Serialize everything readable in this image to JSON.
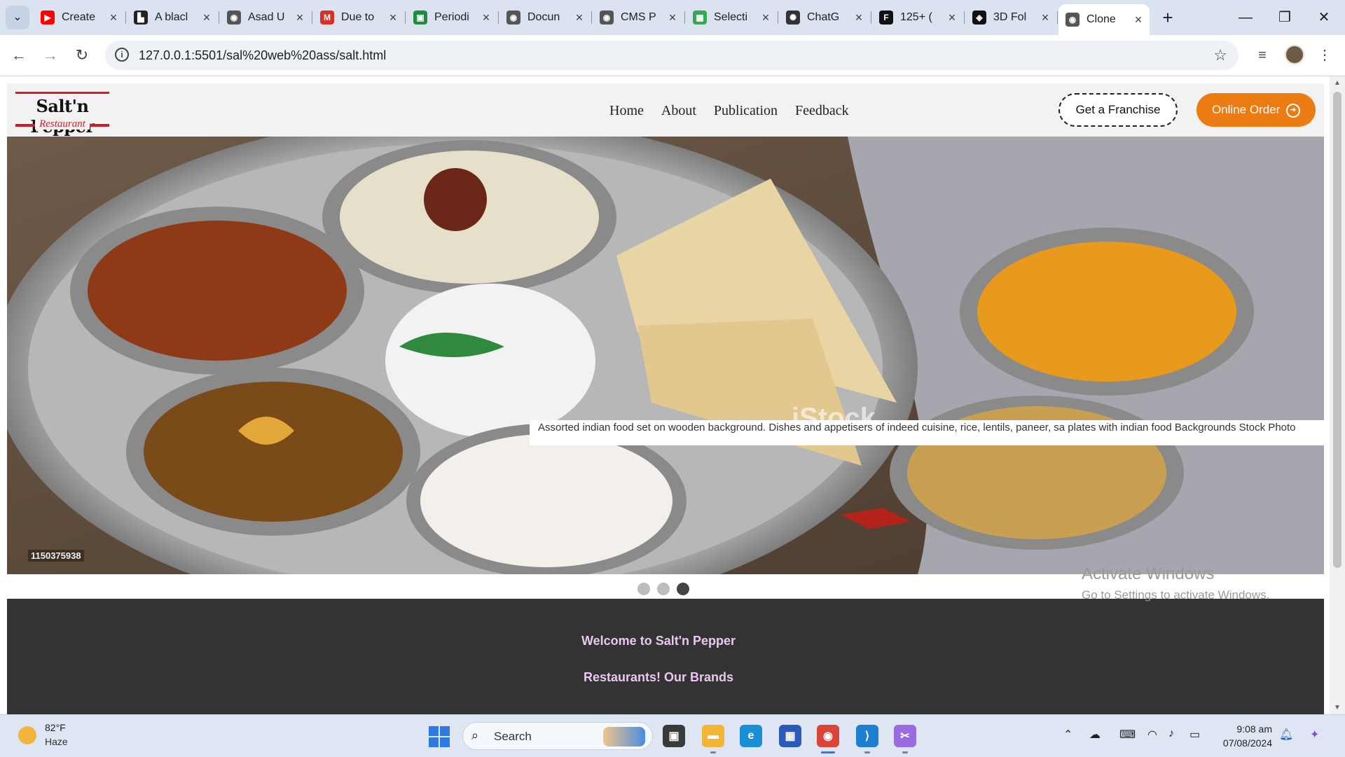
{
  "browser": {
    "tabs": [
      {
        "title": "Create",
        "favicon": "youtube-icon",
        "color": "#ff0000",
        "glyph": "▶"
      },
      {
        "title": "A blacl",
        "favicon": "document-icon",
        "color": "#222222",
        "glyph": "▙"
      },
      {
        "title": "Asad U",
        "favicon": "globe-icon",
        "color": "#555555",
        "glyph": "◉"
      },
      {
        "title": "Due to",
        "favicon": "gmail-icon",
        "color": "#d93025",
        "glyph": "M"
      },
      {
        "title": "Periodi",
        "favicon": "classroom-icon",
        "color": "#1e8e3e",
        "glyph": "▣"
      },
      {
        "title": "Docun",
        "favicon": "globe-icon",
        "color": "#555555",
        "glyph": "◉"
      },
      {
        "title": "CMS P",
        "favicon": "globe-icon",
        "color": "#555555",
        "glyph": "◉"
      },
      {
        "title": "Selecti",
        "favicon": "grid-icon",
        "color": "#34a853",
        "glyph": "▦"
      },
      {
        "title": "ChatG",
        "favicon": "chatgpt-icon",
        "color": "#333333",
        "glyph": "✺"
      },
      {
        "title": "125+ (",
        "favicon": "f-icon",
        "color": "#111111",
        "glyph": "F"
      },
      {
        "title": "3D Fol",
        "favicon": "codepen-icon",
        "color": "#111111",
        "glyph": "◈"
      },
      {
        "title": "Clone",
        "favicon": "globe-icon",
        "color": "#555555",
        "glyph": "◉"
      }
    ],
    "active_tab_index": 11,
    "url": "127.0.0.1:5501/sal%20web%20ass/salt.html"
  },
  "site": {
    "logo": {
      "brand": "Salt'n Pepper",
      "tagline": "Restaurant"
    },
    "nav": [
      "Home",
      "About",
      "Publication",
      "Feedback"
    ],
    "franchise_label": "Get a Franchise",
    "order_label": "Online Order",
    "hero": {
      "watermark": "iStock",
      "caption": "Assorted indian food set on wooden background. Dishes and appetisers of indeed cuisine, rice, lentils, paneer, sa plates with indian food Backgrounds Stock Photo",
      "stock_id": "1150375938"
    },
    "carousel": {
      "slides": 3,
      "active": 2
    },
    "welcome": {
      "line1": "Welcome to Salt'n Pepper",
      "line2": "Restaurants! Our Brands"
    },
    "accent_color": "#ed7b14"
  },
  "os": {
    "activate_title": "Activate Windows",
    "activate_sub": "Go to Settings to activate Windows.",
    "weather_temp": "82°F",
    "weather_desc": "Haze",
    "search_label": "Search",
    "time": "9:08 am",
    "date": "07/08/2024"
  }
}
